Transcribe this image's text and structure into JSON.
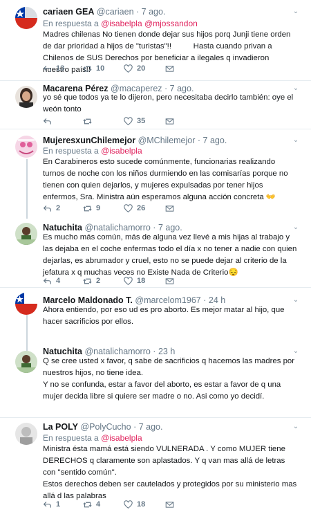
{
  "tweets": [
    {
      "name": "cariaen GEA",
      "handle": "@cariaen",
      "time": "7 ago.",
      "reply_prefix": "En respuesta a",
      "reply_mentions": "@isabelpla @mjossandon",
      "text": "Madres chilenas No tienen donde dejar sus hijos porq Junji tiene orden de dar prioridad a hijos de \"turistas\"!!          Hasta cuando privan a Chilenos de SUS Derechos por beneficiar a ilegales q invadieron nuestro país!!",
      "replies": "13",
      "retweets": "10",
      "likes": "20"
    },
    {
      "name": "Macarena Pérez",
      "handle": "@macaperez",
      "time": "7 ago.",
      "text": "yo sé que todos ya te lo dijeron, pero necesitaba decirlo también: oye el weón tonto",
      "replies": "",
      "retweets": "",
      "likes": "35"
    },
    {
      "name": "MujeresxunChilemejor",
      "handle": "@MChilemejor",
      "time": "7 ago.",
      "reply_prefix": "En respuesta a",
      "reply_mentions": "@isabelpla",
      "text": "En Carabineros esto sucede comúnmente, funcionarias realizando turnos de noche con los niños durmiendo en las comisarías porque no tienen con quien dejarlos, y mujeres expulsadas por tener hijos enfermos, Sra. Ministra aún esperamos alguna acción concreta 👐",
      "replies": "2",
      "retweets": "9",
      "likes": "26"
    },
    {
      "name": "Natuchita",
      "handle": "@natalichamorro",
      "time": "7 ago.",
      "text": "Es mucho más común, más de alguna vez llevé a mis hijas al trabajo y las dejaba en el coche enfermas todo el día x no tener a nadie con quien dejarlas, es abrumador y cruel, esto no se puede dejar al criterio de la jefatura x q muchas veces no Existe Nada de Criterio😔",
      "replies": "4",
      "retweets": "2",
      "likes": "18"
    },
    {
      "name": "Marcelo Maldonado T.",
      "handle": "@marcelom1967",
      "time": "24 h",
      "text": "Ahora entiendo,  por eso ud es pro aborto. Es mejor matar al hijo,  que hacer sacrificios por ellos.",
      "replies": "",
      "retweets": "",
      "likes": ""
    },
    {
      "name": "Natuchita",
      "handle": "@natalichamorro",
      "time": "23 h",
      "text": "Q se cree usted x favor, q sabe de sacrificios q hacemos las madres por nuestros hijos, no tiene idea.\nY no se confunda, estar a favor del aborto, es estar a favor de q una mujer decida libre si quiere ser madre o no. Asi como yo decidí.",
      "replies": "",
      "retweets": "",
      "likes": ""
    },
    {
      "name": "La POLY",
      "handle": "@PolyCucho",
      "time": "7 ago.",
      "reply_prefix": "En respuesta a",
      "reply_mentions": "@isabelpla",
      "text": "Ministra ésta mamá está siendo VULNERADA . Y como MUJER tiene DERECHOS q claramente son aplastados. Y q van mas allá de letras con \"sentido común\".\nEstos derechos deben ser cautelados y protegidos por su ministerio mas allá d las palabras",
      "replies": "1",
      "retweets": "4",
      "likes": "18"
    }
  ],
  "icons": {
    "reply": "reply-icon",
    "retweet": "retweet-icon",
    "like": "heart-icon",
    "dm": "envelope-icon",
    "caret": "chevron-down-icon"
  },
  "colors": {
    "mention": "#e0245e",
    "secondary": "#657786",
    "thread_line": "#ccd6dd",
    "separator": "#e6ecf0"
  }
}
